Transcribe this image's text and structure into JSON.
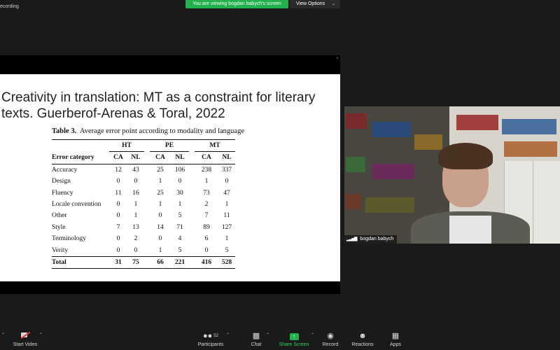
{
  "window": {
    "recording_label": "ecording",
    "share_banner": "You are viewing bogdan babych's screen",
    "view_options_label": "View Options"
  },
  "slide": {
    "title": "Creativity in translation: MT as a constraint for literary texts. Guerberof-Arenas & Toral, 2022",
    "table_caption_label": "Table 3.",
    "table_caption_text": "Average error point according to modality and language",
    "table": {
      "groups": [
        "HT",
        "PE",
        "MT"
      ],
      "first_column_header": "Error category",
      "subheaders": [
        "CA",
        "NL",
        "CA",
        "NL",
        "CA",
        "NL"
      ],
      "rows": [
        {
          "category": "Accuracy",
          "values": [
            "12",
            "43",
            "25",
            "106",
            "238",
            "337"
          ]
        },
        {
          "category": "Design",
          "values": [
            "0",
            "0",
            "1",
            "0",
            "1",
            "0"
          ]
        },
        {
          "category": "Fluency",
          "values": [
            "11",
            "16",
            "25",
            "30",
            "73",
            "47"
          ]
        },
        {
          "category": "Locale convention",
          "values": [
            "0",
            "1",
            "1",
            "1",
            "2",
            "1"
          ]
        },
        {
          "category": "Other",
          "values": [
            "0",
            "1",
            "0",
            "5",
            "7",
            "11"
          ]
        },
        {
          "category": "Style",
          "values": [
            "7",
            "13",
            "14",
            "71",
            "89",
            "127"
          ]
        },
        {
          "category": "Terminology",
          "values": [
            "0",
            "2",
            "0",
            "4",
            "6",
            "1"
          ]
        },
        {
          "category": "Verity",
          "values": [
            "0",
            "0",
            "1",
            "5",
            "0",
            "5"
          ]
        }
      ],
      "total": {
        "category": "Total",
        "values": [
          "31",
          "75",
          "66",
          "221",
          "416",
          "528"
        ]
      }
    }
  },
  "video": {
    "participant_name": "bogdan babych"
  },
  "toolbar": {
    "start_video_label": "Start Video",
    "participants_label": "Participants",
    "participants_count": "52",
    "chat_label": "Chat",
    "share_screen_label": "Share Screen",
    "record_label": "Record",
    "reactions_label": "Reactions",
    "apps_label": "Apps"
  },
  "colors": {
    "share_banner_green": "#22b14c",
    "share_screen_label_green": "#2fd05e",
    "video_off_red": "#e53935",
    "background": "#1a1a1a"
  }
}
